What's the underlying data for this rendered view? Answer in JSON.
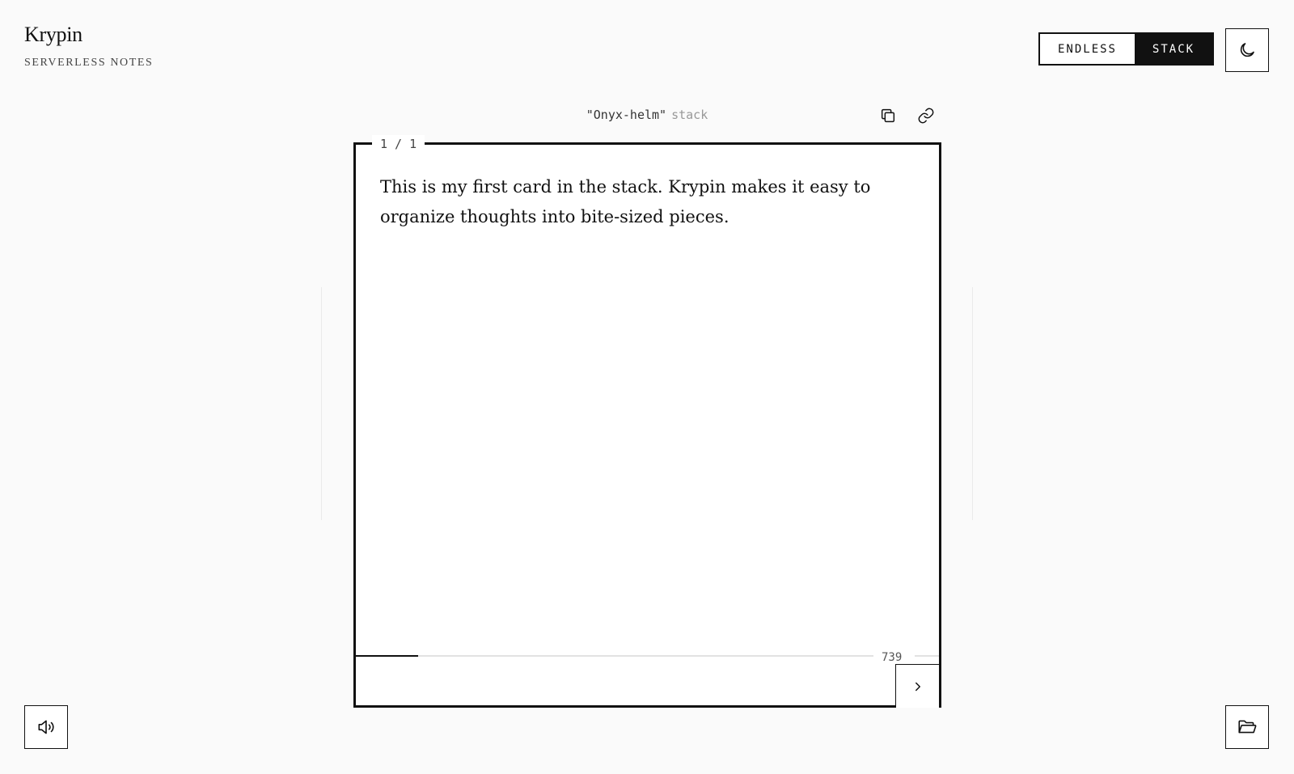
{
  "brand": {
    "title": "Krypin",
    "subtitle": "SERVERLESS NOTES"
  },
  "mode_toggle": {
    "endless_label": "ENDLESS",
    "stack_label": "STACK",
    "selected": "STACK"
  },
  "stack": {
    "name": "\"Onyx-helm\"",
    "suffix": "stack"
  },
  "card": {
    "counter": "1 / 1",
    "text": "This is my first card in the stack. Krypin makes it easy to organize thoughts into bite-sized pieces.",
    "char_count": "739",
    "progress": 0.12
  },
  "icons": {
    "theme": "moon-icon",
    "copy": "copy-icon",
    "link": "link-icon",
    "next": "chevron-right-icon",
    "sound": "speaker-icon",
    "folder": "folder-open-icon"
  },
  "colors": {
    "background": "#fafafa",
    "ink": "#111111",
    "muted": "#999999"
  }
}
